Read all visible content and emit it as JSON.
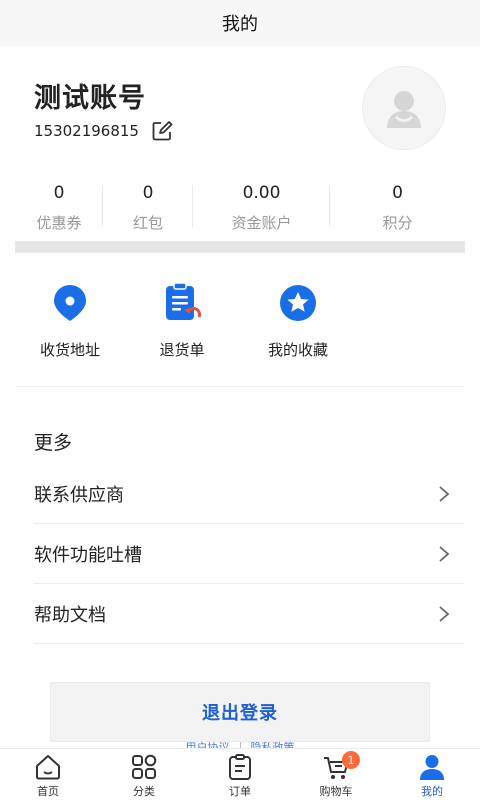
{
  "header": {
    "title": "我的"
  },
  "profile": {
    "name": "测试账号",
    "phone": "15302196815"
  },
  "stats": [
    {
      "value": "0",
      "label": "优惠券"
    },
    {
      "value": "0",
      "label": "红包"
    },
    {
      "value": "0.00",
      "label": "资金账户"
    },
    {
      "value": "0",
      "label": "积分"
    }
  ],
  "shortcuts": [
    {
      "label": "收货地址",
      "icon": "location-pin-icon"
    },
    {
      "label": "退货单",
      "icon": "return-order-icon"
    },
    {
      "label": "我的收藏",
      "icon": "star-icon"
    }
  ],
  "more": {
    "title": "更多",
    "items": [
      {
        "label": "联系供应商"
      },
      {
        "label": "软件功能吐槽"
      },
      {
        "label": "帮助文档"
      }
    ]
  },
  "logout": {
    "label": "退出登录"
  },
  "legal": {
    "left": "用户协议",
    "right": "隐私政策"
  },
  "tabs": [
    {
      "label": "首页",
      "icon": "home-icon"
    },
    {
      "label": "分类",
      "icon": "category-icon"
    },
    {
      "label": "订单",
      "icon": "order-icon"
    },
    {
      "label": "购物车",
      "icon": "cart-icon",
      "badge": "1"
    },
    {
      "label": "我的",
      "icon": "user-icon",
      "active": true
    }
  ],
  "colors": {
    "accent": "#1d5fd6",
    "icon_blue": "#1a6ee8",
    "badge": "#ff6a3d"
  }
}
